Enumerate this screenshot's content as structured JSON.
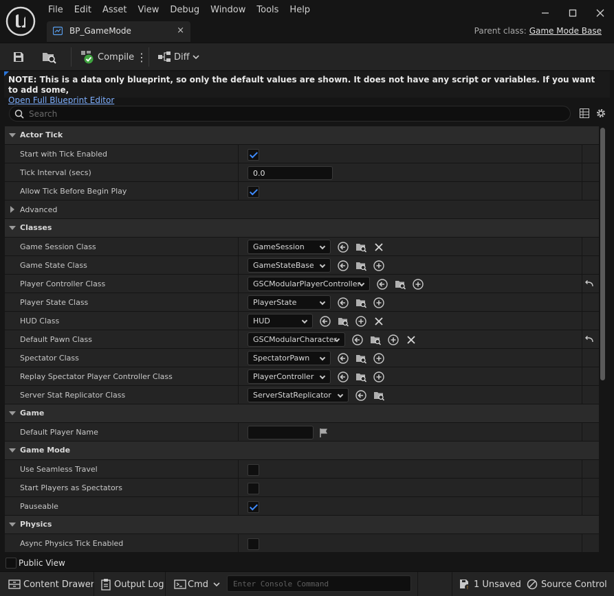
{
  "menu": [
    "File",
    "Edit",
    "Asset",
    "View",
    "Debug",
    "Window",
    "Tools",
    "Help"
  ],
  "tab": {
    "label": "BP_GameMode",
    "close": "×"
  },
  "parent_class": {
    "label": "Parent class:",
    "value": "Game Mode Base"
  },
  "toolbar": {
    "compile": "Compile",
    "more": "⋮",
    "diff": "Diff"
  },
  "note": {
    "text": "NOTE: This is a data only blueprint, so only the default values are shown.  It does not have any script or variables.  If you want to add some,",
    "link": "Open Full Blueprint Editor"
  },
  "search": {
    "placeholder": "Search"
  },
  "details": {
    "actor_tick": {
      "title": "Actor Tick",
      "start_with_tick": {
        "label": "Start with Tick Enabled",
        "checked": true
      },
      "tick_interval": {
        "label": "Tick Interval (secs)",
        "value": "0.0"
      },
      "allow_tick": {
        "label": "Allow Tick Before Begin Play",
        "checked": true
      },
      "advanced": "Advanced"
    },
    "classes": {
      "title": "Classes",
      "game_session": {
        "label": "Game Session Class",
        "value": "GameSession"
      },
      "game_state": {
        "label": "Game State Class",
        "value": "GameStateBase"
      },
      "player_controller": {
        "label": "Player Controller Class",
        "value": "GSCModularPlayerController"
      },
      "player_state": {
        "label": "Player State Class",
        "value": "PlayerState"
      },
      "hud": {
        "label": "HUD Class",
        "value": "HUD"
      },
      "default_pawn": {
        "label": "Default Pawn Class",
        "value": "GSCModularCharacter"
      },
      "spectator": {
        "label": "Spectator Class",
        "value": "SpectatorPawn"
      },
      "replay_spectator": {
        "label": "Replay Spectator Player Controller Class",
        "value": "PlayerController"
      },
      "server_stat": {
        "label": "Server Stat Replicator Class",
        "value": "ServerStatReplicator"
      }
    },
    "game": {
      "title": "Game",
      "default_player_name": {
        "label": "Default Player Name",
        "value": ""
      }
    },
    "game_mode": {
      "title": "Game Mode",
      "seamless_travel": {
        "label": "Use Seamless Travel",
        "checked": false
      },
      "start_spectators": {
        "label": "Start Players as Spectators",
        "checked": false
      },
      "pauseable": {
        "label": "Pauseable",
        "checked": true
      }
    },
    "physics": {
      "title": "Physics",
      "async_tick": {
        "label": "Async Physics Tick Enabled",
        "checked": false
      }
    }
  },
  "public_view": "Public View",
  "statusbar": {
    "content_drawer": "Content Drawer",
    "output_log": "Output Log",
    "cmd": "Cmd",
    "console_placeholder": "Enter Console Command",
    "unsaved": "1 Unsaved",
    "source_control": "Source Control"
  }
}
